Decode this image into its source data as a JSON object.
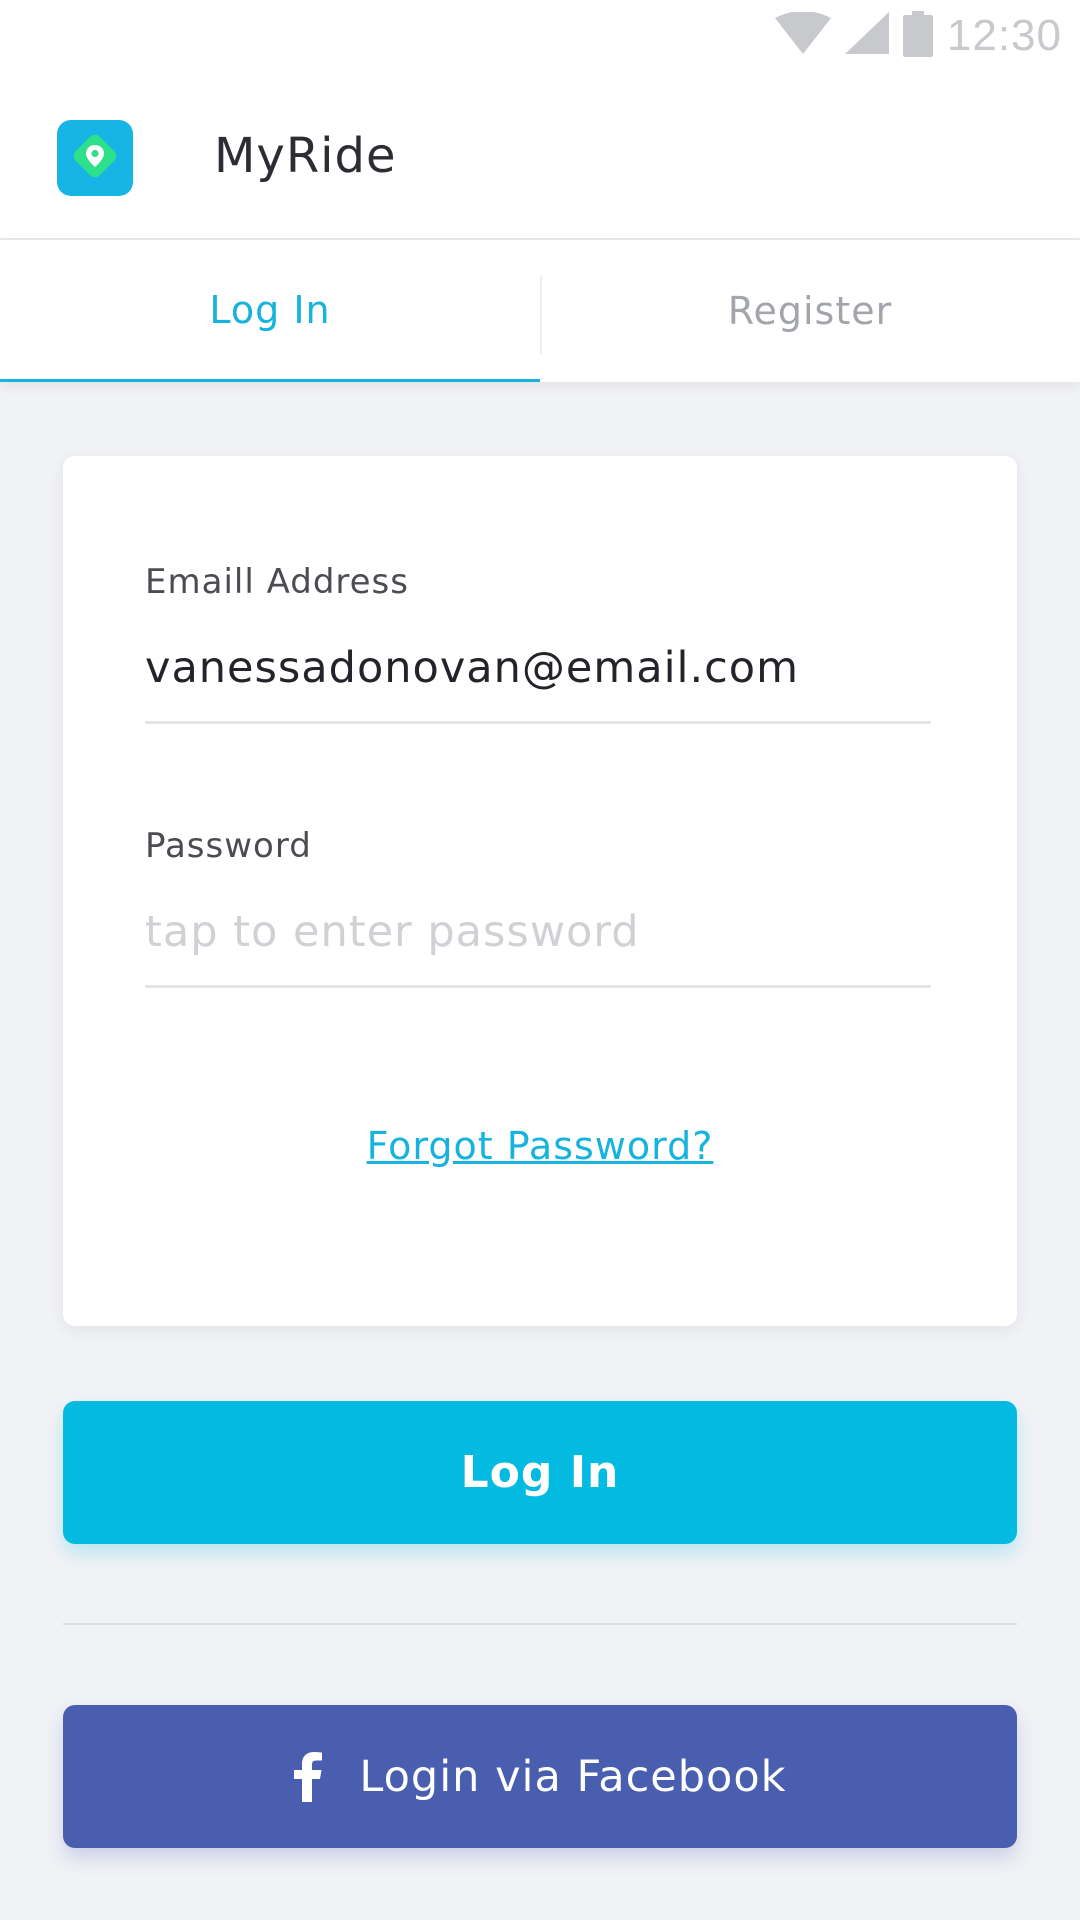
{
  "status_bar": {
    "time": "12:30",
    "icons": [
      "wifi-icon",
      "signal-icon",
      "battery-icon"
    ]
  },
  "app": {
    "name": "MyRide",
    "logo_icon": "map-pin-icon"
  },
  "tabs": [
    {
      "label": "Log In",
      "active": true
    },
    {
      "label": "Register",
      "active": false
    }
  ],
  "form": {
    "email": {
      "label": "Emaill Address",
      "value": "vanessadonovan@email.com",
      "placeholder": ""
    },
    "password": {
      "label": "Password",
      "value": "",
      "placeholder": "tap to enter password"
    },
    "forgot_label": "Forgot Password?"
  },
  "actions": {
    "login_label": "Log In",
    "facebook_label": "Login via Facebook",
    "facebook_icon": "facebook-icon"
  },
  "colors": {
    "accent": "#16b3df",
    "login_button": "#03bae0",
    "facebook_button": "#4a5eb0",
    "logo_pin": "#2ee08c",
    "background": "#f1f2f6"
  }
}
